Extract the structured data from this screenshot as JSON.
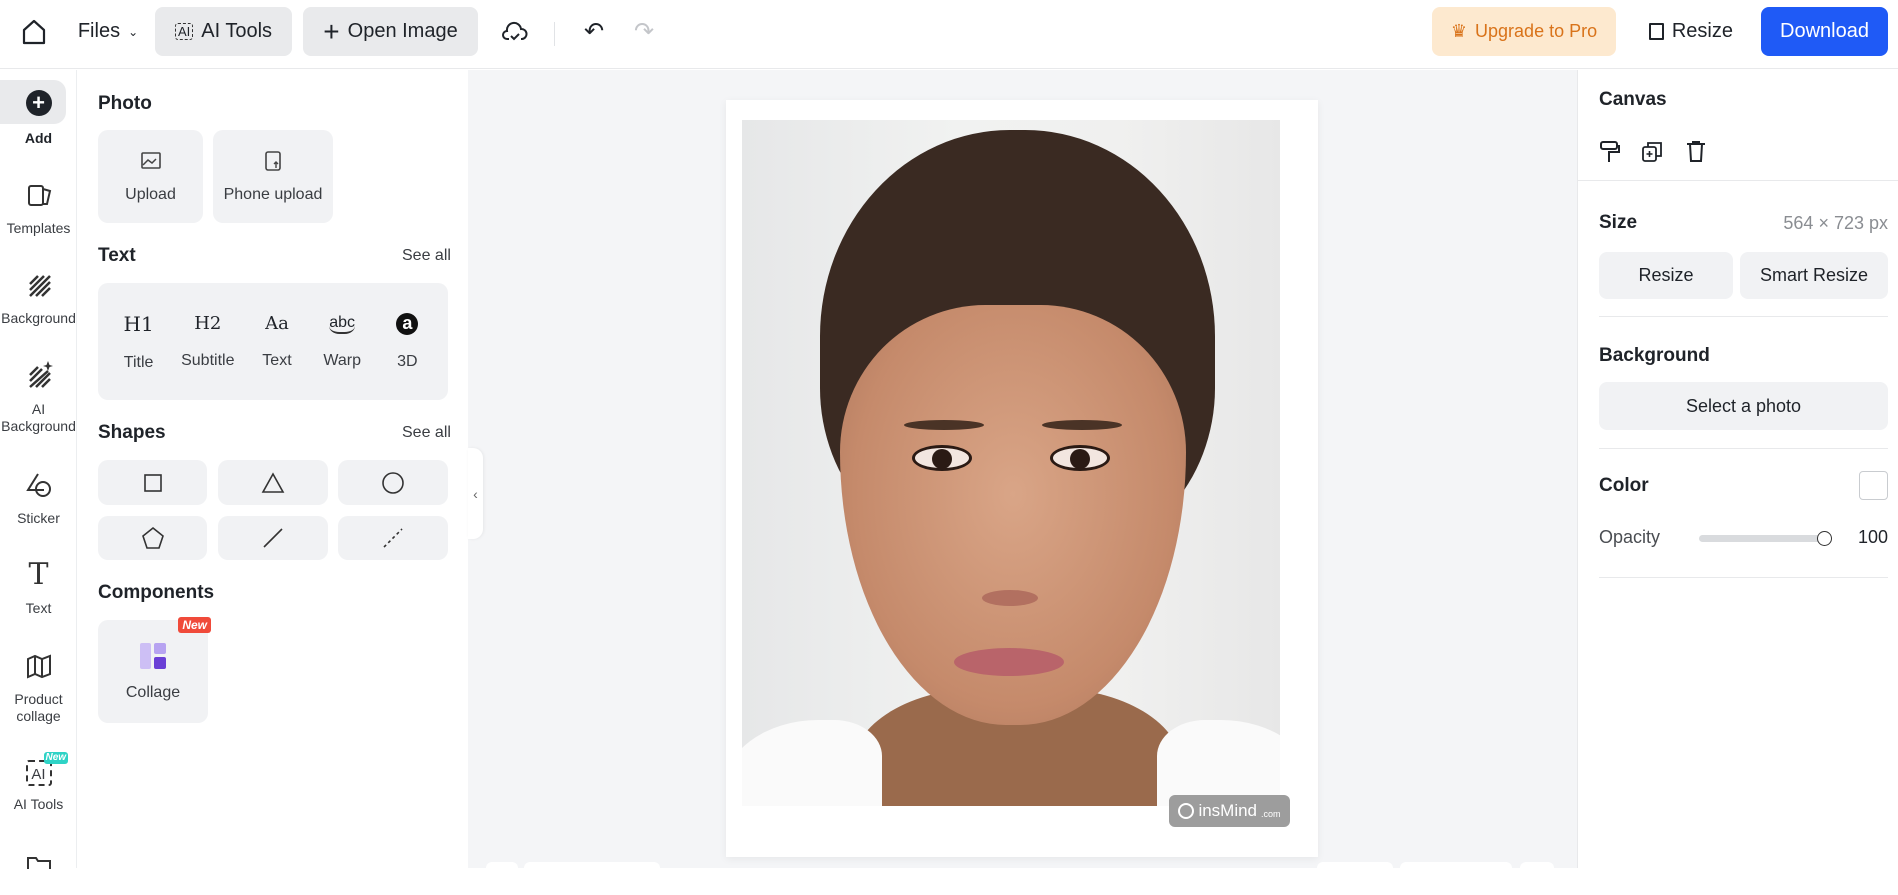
{
  "topbar": {
    "files_label": "Files",
    "ai_tools_label": "AI Tools",
    "open_image_label": "Open Image",
    "upgrade_label": "Upgrade to Pro",
    "resize_label": "Resize",
    "download_label": "Download"
  },
  "rail": {
    "items": [
      {
        "label": "Add",
        "icon": "plus-circle-icon",
        "active": true
      },
      {
        "label": "Templates",
        "icon": "templates-icon"
      },
      {
        "label": "Background",
        "icon": "hatch-icon"
      },
      {
        "label": "AI Background",
        "icon": "ai-hatch-icon"
      },
      {
        "label": "Sticker",
        "icon": "sticker-icon"
      },
      {
        "label": "Text",
        "icon": "text-icon"
      },
      {
        "label": "Product collage",
        "icon": "map-icon"
      },
      {
        "label": "AI Tools",
        "icon": "ai-icon",
        "badge": "New"
      }
    ]
  },
  "panel": {
    "photo": {
      "title": "Photo",
      "upload": "Upload",
      "phone_upload": "Phone upload"
    },
    "text": {
      "title": "Text",
      "see_all": "See all",
      "items": [
        {
          "glyph": "H1",
          "label": "Title"
        },
        {
          "glyph": "H2",
          "label": "Subtitle"
        },
        {
          "glyph": "Aa",
          "label": "Text"
        },
        {
          "glyph": "abc",
          "label": "Warp"
        },
        {
          "glyph": "a",
          "label": "3D"
        }
      ]
    },
    "shapes": {
      "title": "Shapes",
      "see_all": "See all",
      "items": [
        "square",
        "triangle",
        "circle",
        "pentagon",
        "line",
        "dashed-line"
      ]
    },
    "components": {
      "title": "Components",
      "collage": "Collage",
      "badge": "New"
    }
  },
  "canvas": {
    "watermark": "insMind",
    "watermark_suffix": ".com"
  },
  "right": {
    "canvas_title": "Canvas",
    "size_title": "Size",
    "size_value": "564 × 723 px",
    "resize": "Resize",
    "smart_resize": "Smart Resize",
    "background_title": "Background",
    "select_photo": "Select a photo",
    "color_title": "Color",
    "color_value": "#ffffff",
    "opacity_label": "Opacity",
    "opacity_value": "100"
  },
  "colors": {
    "accent": "#1f5af6",
    "upgrade_bg": "#fde9cf",
    "upgrade_text": "#d9731a",
    "badge_red": "#f04a3a",
    "badge_teal": "#2ed3c6"
  }
}
